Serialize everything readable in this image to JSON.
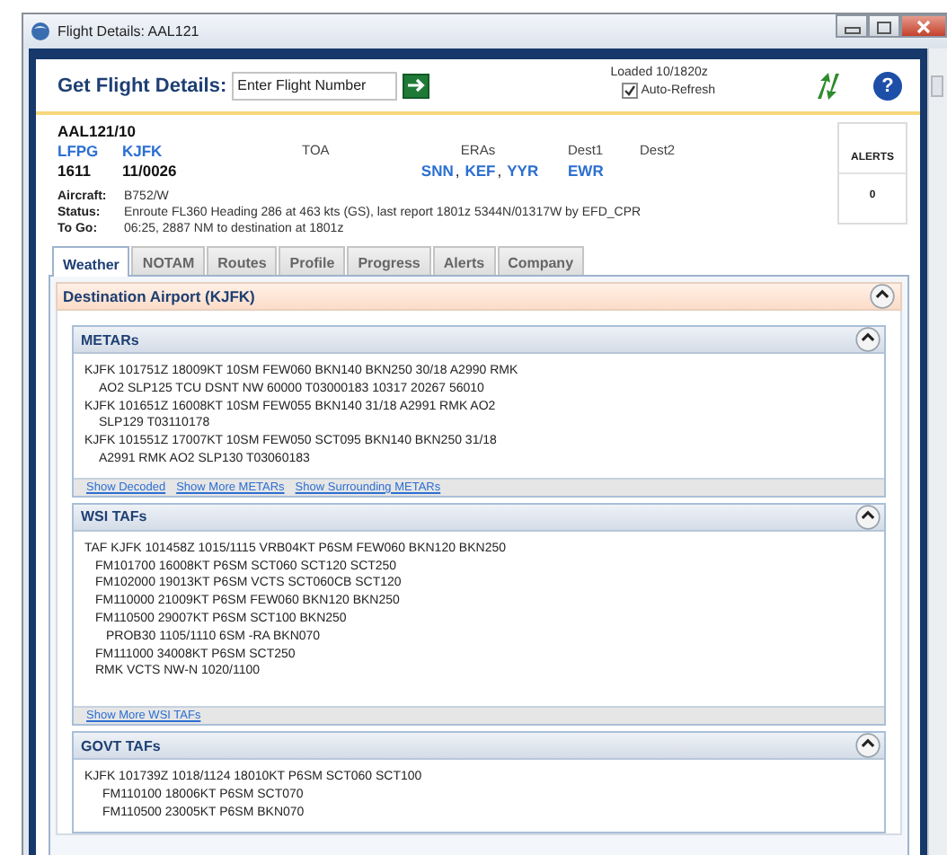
{
  "window": {
    "title": "Flight Details: AAL121"
  },
  "header": {
    "label": "Get Flight Details:",
    "flight_field": {
      "placeholder": "Enter Flight Number"
    },
    "loaded": "Loaded 10/1820z",
    "auto_refresh": {
      "label": "Auto-Refresh",
      "checked": true
    }
  },
  "flight": {
    "id": "AAL121/10",
    "origin": "LFPG",
    "destination": "KJFK",
    "departure": "1611",
    "arrival": "11/0026",
    "toa_label": "TOA",
    "eras_label": "ERAs",
    "eras": [
      "SNN",
      "KEF",
      "YYR"
    ],
    "eras_separator": ",",
    "dest1_label": "Dest1",
    "dest1": "EWR",
    "dest2_label": "Dest2",
    "details": [
      {
        "label": "Aircraft:",
        "value": "B752/W"
      },
      {
        "label": "Status:",
        "value": "Enroute FL360 Heading 286 at 463 kts (GS), last report 1801z 5344N/01317W by EFD_CPR"
      },
      {
        "label": "To Go:",
        "value": "06:25, 2887 NM to destination at 1801z"
      }
    ],
    "alerts": {
      "label": "ALERTS",
      "count": "0"
    }
  },
  "help": {
    "symbol": "?"
  },
  "tabs": [
    {
      "label": "Weather",
      "selected": true
    },
    {
      "label": "NOTAM",
      "selected": false
    },
    {
      "label": "Routes",
      "selected": false
    },
    {
      "label": "Profile",
      "selected": false
    },
    {
      "label": "Progress",
      "selected": false
    },
    {
      "label": "Alerts",
      "selected": false
    },
    {
      "label": "Company",
      "selected": false
    }
  ],
  "section": {
    "title": "Destination Airport (KJFK)",
    "expanded": true,
    "panels": [
      {
        "title": "METARs",
        "expanded": true,
        "reports": [
          {
            "text": "KJFK 101751Z 18009KT 10SM FEW060 BKN140 BKN250 30/18 A2990 RMK",
            "children": [
              {
                "text": "AO2 SLP125 TCU DSNT NW 60000 T03000183 10317 20267 56010"
              }
            ]
          },
          {
            "text": "KJFK 101651Z 16008KT 10SM FEW055 BKN140 31/18 A2991 RMK AO2",
            "children": [
              {
                "text": "SLP129 T03110178"
              }
            ]
          },
          {
            "text": "KJFK 101551Z 17007KT 10SM FEW050 SCT095 BKN140 BKN250 31/18",
            "children": [
              {
                "text": "A2991 RMK AO2 SLP130 T03060183"
              }
            ]
          }
        ],
        "links": [
          "Show Decoded",
          "Show More METARs",
          "Show Surrounding METARs"
        ]
      },
      {
        "title": "WSI TAFs",
        "expanded": true,
        "reports": [
          {
            "text": "TAF KJFK 101458Z 1015/1115 VRB04KT P6SM FEW060 BKN120 BKN250",
            "children": [
              {
                "text": "FM101700 16008KT P6SM SCT060 SCT120 SCT250"
              },
              {
                "text": "FM102000 19013KT P6SM VCTS SCT060CB SCT120"
              },
              {
                "text": "FM110000 21009KT P6SM FEW060 BKN120 BKN250"
              },
              {
                "text": "FM110500 29007KT P6SM SCT100 BKN250",
                "children": [
                  {
                    "text": "PROB30 1105/1110 6SM -RA BKN070"
                  }
                ]
              },
              {
                "text": "FM111000 34008KT P6SM SCT250"
              },
              {
                "text": "RMK VCTS NW-N 1020/1100"
              }
            ]
          }
        ],
        "links": [
          "Show More WSI TAFs"
        ]
      },
      {
        "title": "GOVT TAFs",
        "expanded": true,
        "reports": [
          {
            "text": "KJFK 101739Z 1018/1124 18010KT P6SM SCT060 SCT100",
            "children": [
              {
                "text": "FM110100 18006KT P6SM SCT070"
              },
              {
                "text": "FM110500 23005KT P6SM BKN070"
              }
            ]
          }
        ]
      }
    ]
  }
}
